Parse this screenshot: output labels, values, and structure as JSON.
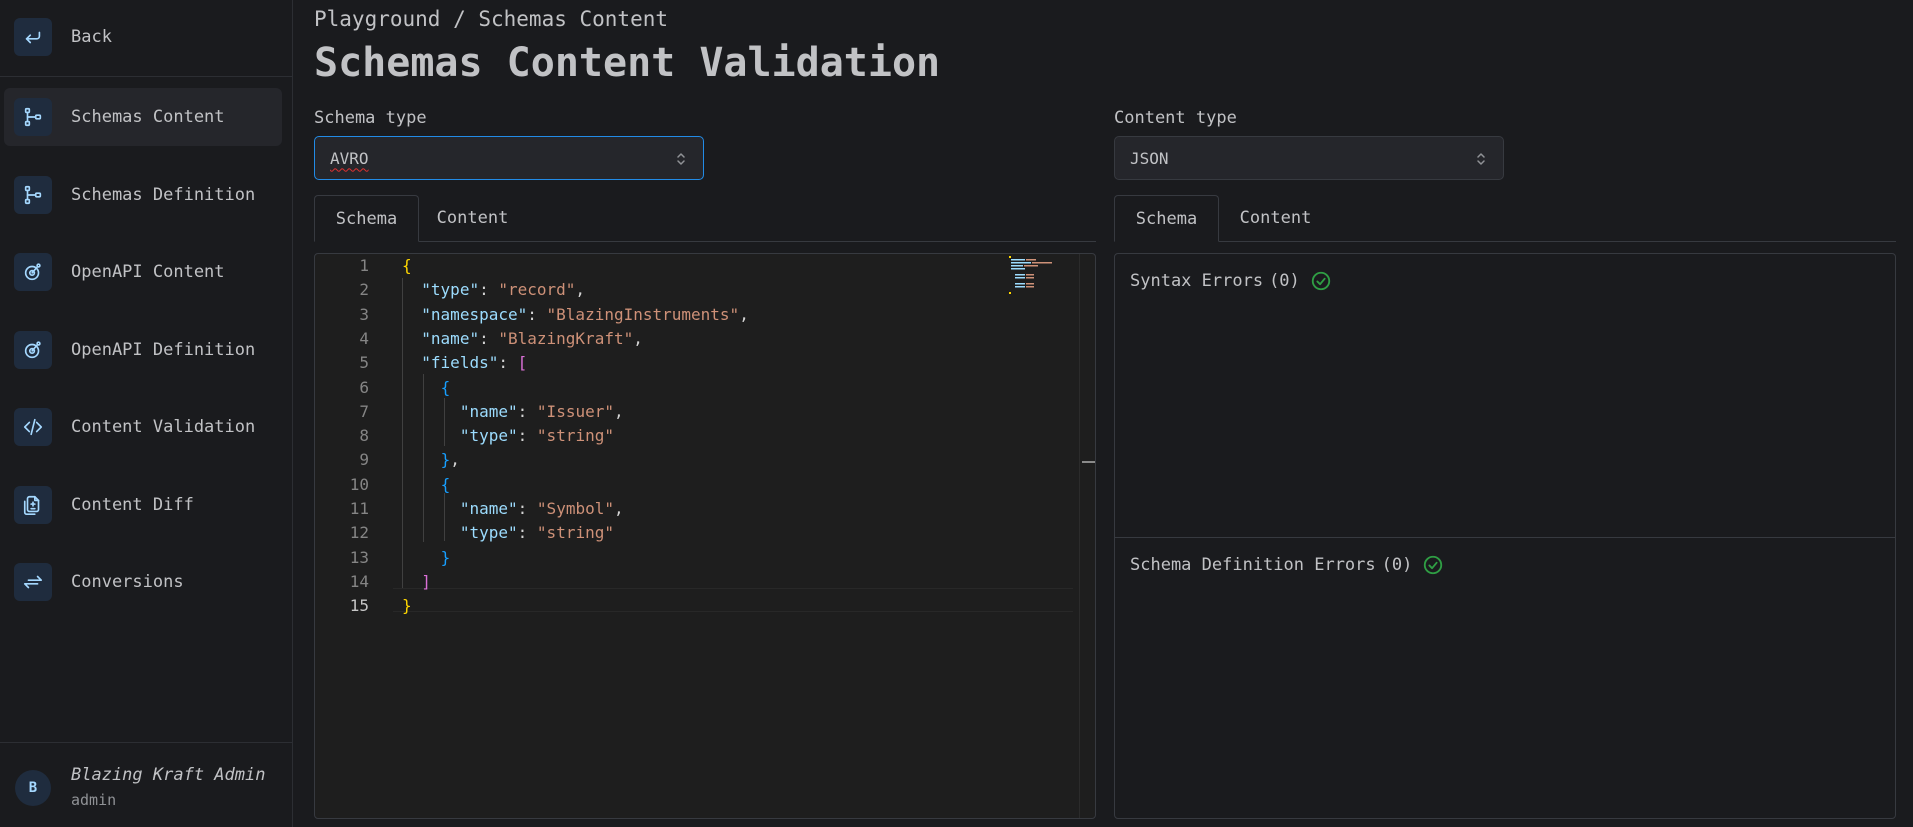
{
  "sidebar": {
    "back_label": "Back",
    "items": [
      {
        "label": "Schemas Content",
        "icon": "schema-tree-icon",
        "active": true
      },
      {
        "label": "Schemas Definition",
        "icon": "schema-tree-icon",
        "active": false
      },
      {
        "label": "OpenAPI Content",
        "icon": "openapi-icon",
        "active": false
      },
      {
        "label": "OpenAPI Definition",
        "icon": "openapi-icon",
        "active": false
      },
      {
        "label": "Content Validation",
        "icon": "code-icon",
        "active": false
      },
      {
        "label": "Content Diff",
        "icon": "file-diff-icon",
        "active": false
      },
      {
        "label": "Conversions",
        "icon": "arrows-exchange-icon",
        "active": false
      }
    ],
    "user": {
      "initial": "B",
      "name": "Blazing Kraft Admin",
      "role": "admin"
    }
  },
  "header": {
    "breadcrumb": "Playground / Schemas Content",
    "title": "Schemas Content Validation"
  },
  "left": {
    "select_label": "Schema type",
    "select_value": "AVRO",
    "tabs": [
      {
        "label": "Schema",
        "active": true
      },
      {
        "label": "Content",
        "active": false
      }
    ]
  },
  "right": {
    "select_label": "Content type",
    "select_value": "JSON",
    "tabs": [
      {
        "label": "Schema",
        "active": true
      },
      {
        "label": "Content",
        "active": false
      }
    ],
    "syntax_errors": {
      "label": "Syntax Errors",
      "count": "(0)"
    },
    "definition_errors": {
      "label": "Schema Definition Errors",
      "count": "(0)"
    }
  },
  "editor": {
    "current_line": 15,
    "lines": [
      {
        "n": "1",
        "code": "{"
      },
      {
        "n": "2",
        "code": "  \"type\": \"record\","
      },
      {
        "n": "3",
        "code": "  \"namespace\": \"BlazingInstruments\","
      },
      {
        "n": "4",
        "code": "  \"name\": \"BlazingKraft\","
      },
      {
        "n": "5",
        "code": "  \"fields\": ["
      },
      {
        "n": "6",
        "code": "    {"
      },
      {
        "n": "7",
        "code": "      \"name\": \"Issuer\","
      },
      {
        "n": "8",
        "code": "      \"type\": \"string\""
      },
      {
        "n": "9",
        "code": "    },"
      },
      {
        "n": "10",
        "code": "    {"
      },
      {
        "n": "11",
        "code": "      \"name\": \"Symbol\","
      },
      {
        "n": "12",
        "code": "      \"type\": \"string\""
      },
      {
        "n": "13",
        "code": "    }"
      },
      {
        "n": "14",
        "code": "  ]"
      },
      {
        "n": "15",
        "code": "}"
      }
    ]
  },
  "colors": {
    "background": "#1a1b1e",
    "accent": "#228be6",
    "success": "#2f9e44",
    "icon_tint": "#a5d8ff"
  }
}
